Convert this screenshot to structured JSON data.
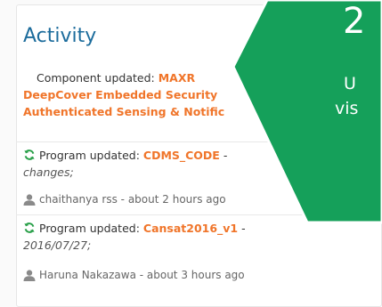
{
  "activity": {
    "title": "Activity",
    "component": {
      "prefix": "Component updated: ",
      "name_line1": "MAXR",
      "name_line2": "DeepCover Embedded Security",
      "name_line3": "Authenticated Sensing & Notific"
    },
    "items": [
      {
        "prefix": "Program updated: ",
        "name": "CDMS_CODE",
        "suffix": " - ",
        "detail": "changes;",
        "user": "chaithanya rss - about 2 hours ago"
      },
      {
        "prefix": "Program updated: ",
        "name": "Cansat2016_v1",
        "suffix": " -",
        "detail": "2016/07/27;",
        "user": "Haruna Nakazawa - about 3 hours ago"
      }
    ]
  },
  "overlay": {
    "big": "2",
    "line1": "U",
    "line2": "vis"
  },
  "colors": {
    "accent_green": "#15a05a",
    "link_orange": "#f0752a",
    "title_blue": "#1c6c9c",
    "refresh_green": "#2aa04a"
  },
  "icons": {
    "refresh": "refresh-icon",
    "user": "user-icon"
  }
}
